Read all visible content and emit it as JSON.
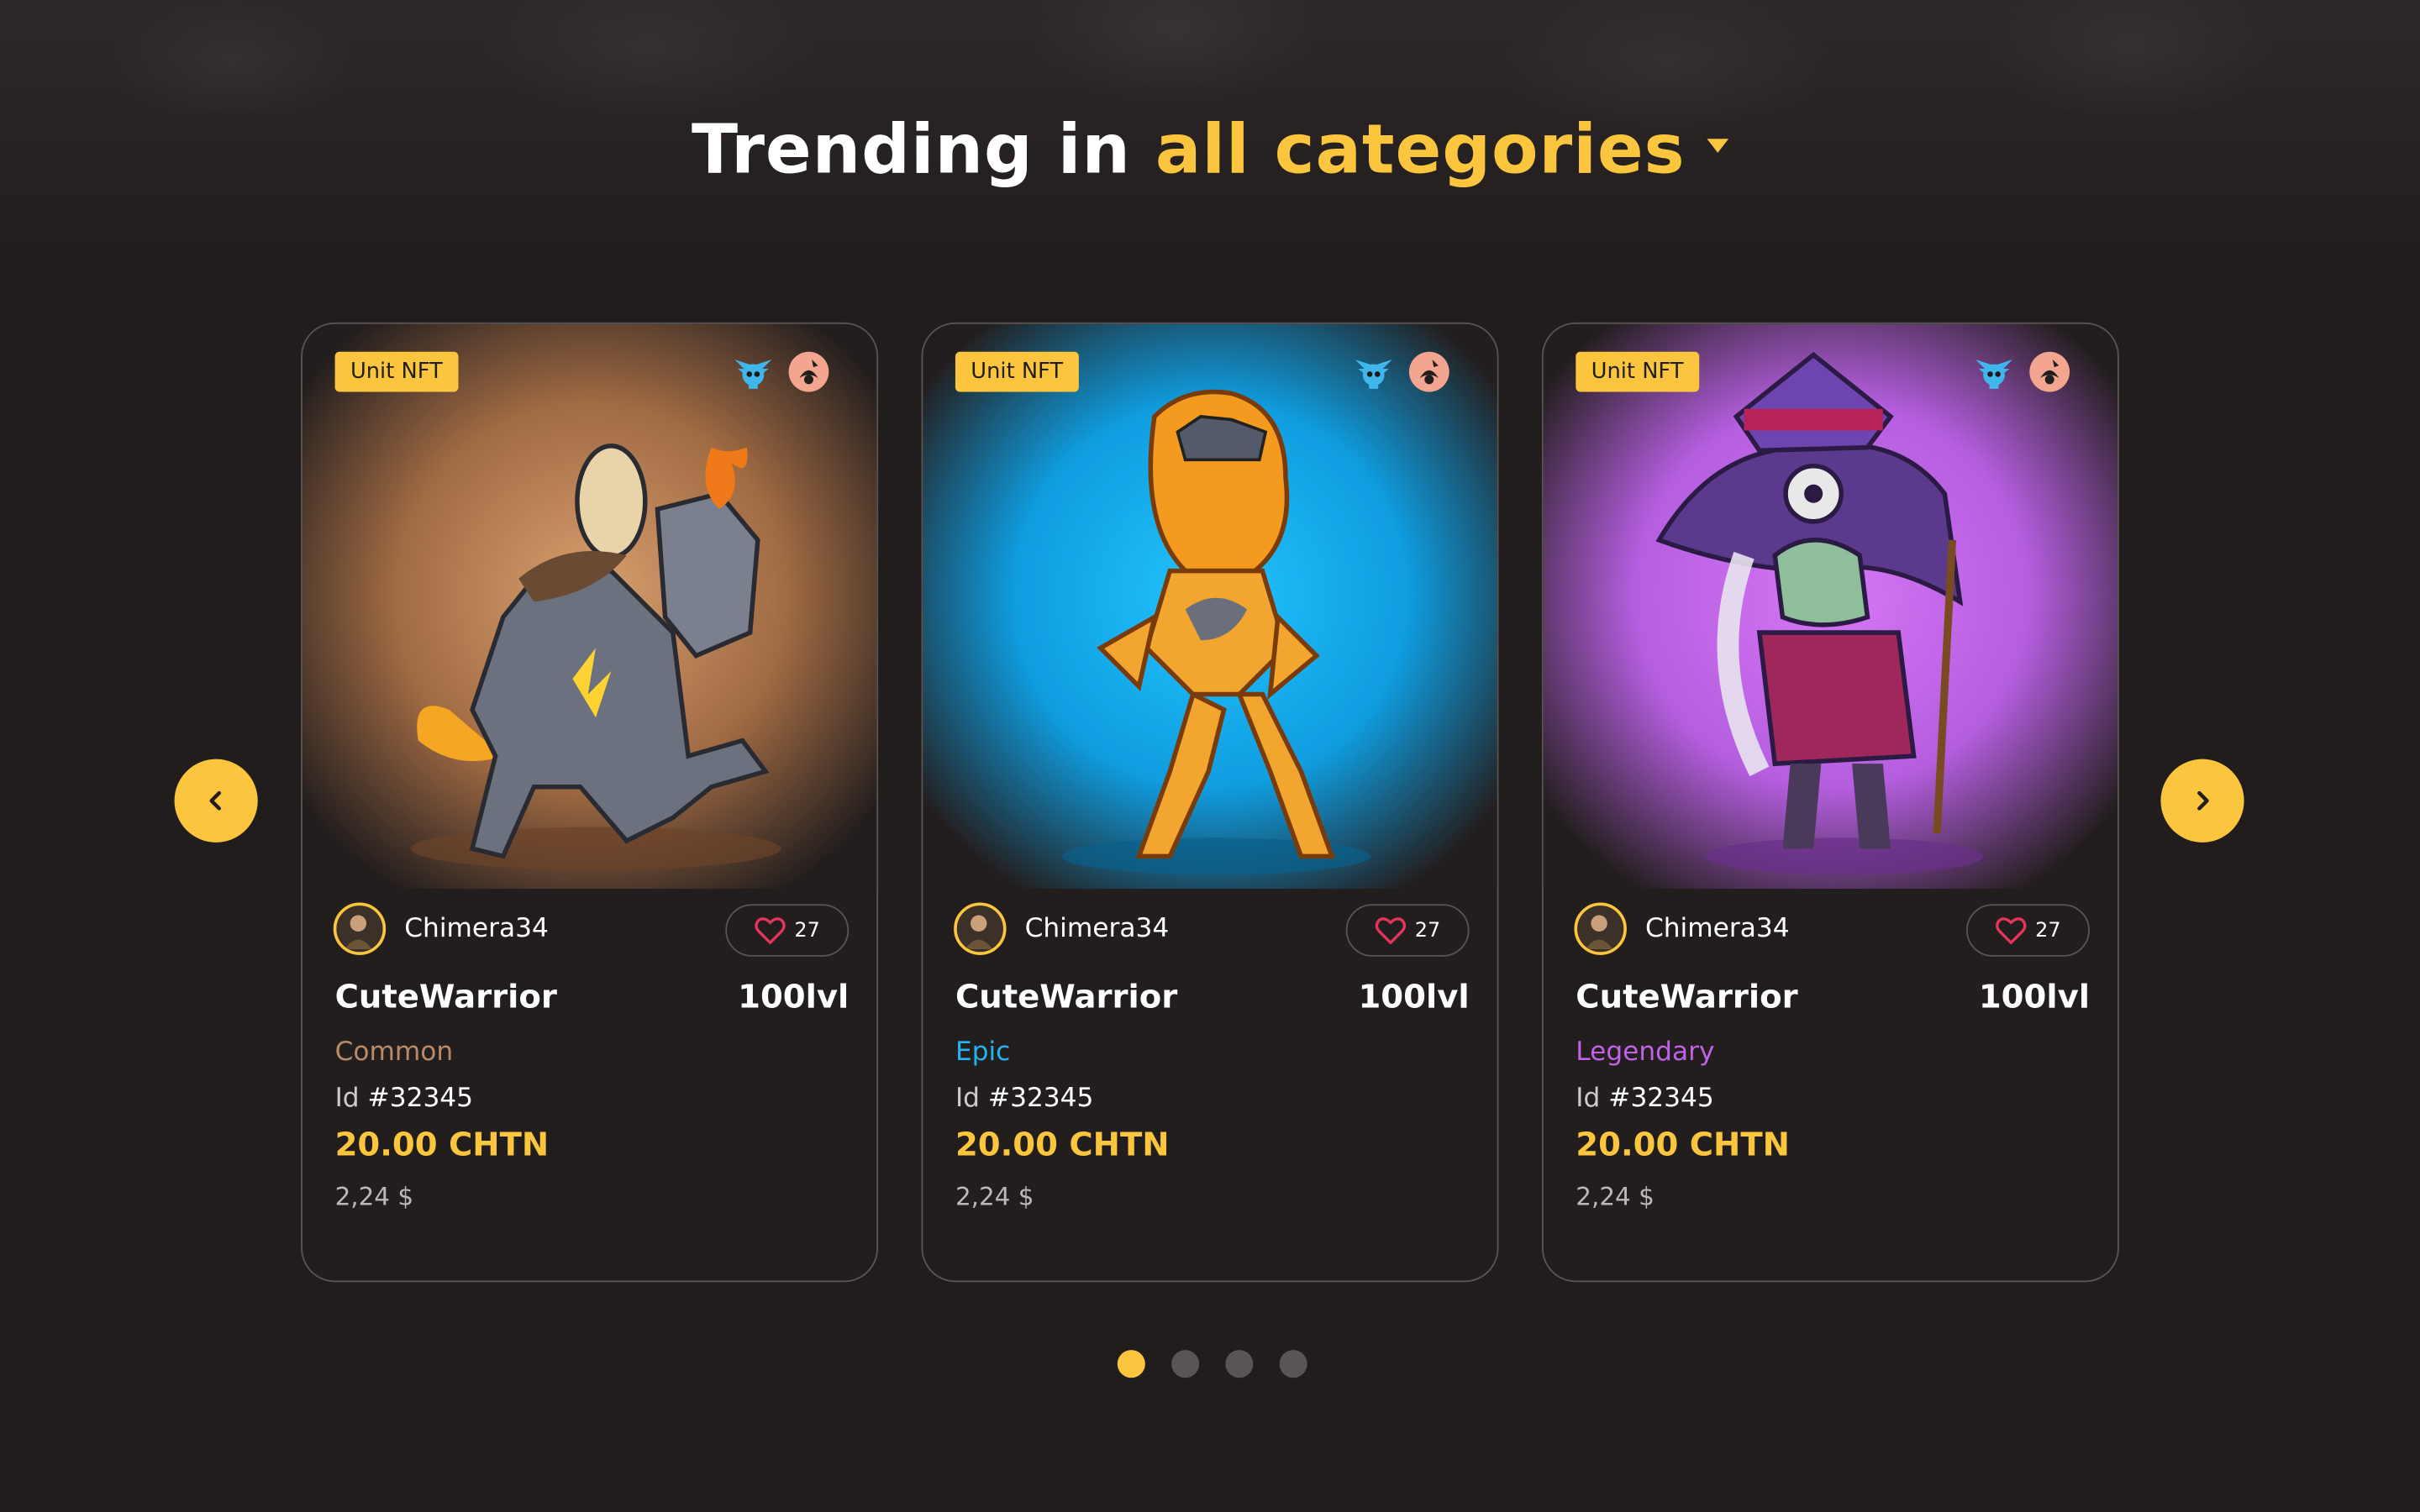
{
  "heading": {
    "prefix": "Trending in",
    "category": "all categories"
  },
  "colors": {
    "accent": "#fbc53d",
    "background": "#221d1d",
    "common": "#b98a68",
    "epic": "#24b3ee",
    "legendary": "#bf62e6",
    "card_border": "#5a5454"
  },
  "cards": [
    {
      "badge": "Unit NFT",
      "icons": [
        "skull-wings-icon",
        "faction-icon"
      ],
      "owner": "Chimera34",
      "likes": "27",
      "name": "CuteWarrior",
      "level": "100lvl",
      "rarity": "Common",
      "id_label": "Id",
      "id_value": "#32345",
      "price": "20.00 CHTN",
      "usd": "2,24 $",
      "art": "stone-golem-with-egg"
    },
    {
      "badge": "Unit NFT",
      "icons": [
        "skull-wings-icon",
        "faction-icon"
      ],
      "owner": "Chimera34",
      "likes": "27",
      "name": "CuteWarrior",
      "level": "100lvl",
      "rarity": "Epic",
      "id_label": "Id",
      "id_value": "#32345",
      "price": "20.00 CHTN",
      "usd": "2,24 $",
      "art": "fire-demoness"
    },
    {
      "badge": "Unit NFT",
      "icons": [
        "skull-wings-icon",
        "faction-icon"
      ],
      "owner": "Chimera34",
      "likes": "27",
      "name": "CuteWarrior",
      "level": "100lvl",
      "rarity": "Legendary",
      "id_label": "Id",
      "id_value": "#32345",
      "price": "20.00 CHTN",
      "usd": "2,24 $",
      "art": "zombie-witch"
    }
  ],
  "carousel": {
    "page_count": 4,
    "active_page": 1
  }
}
